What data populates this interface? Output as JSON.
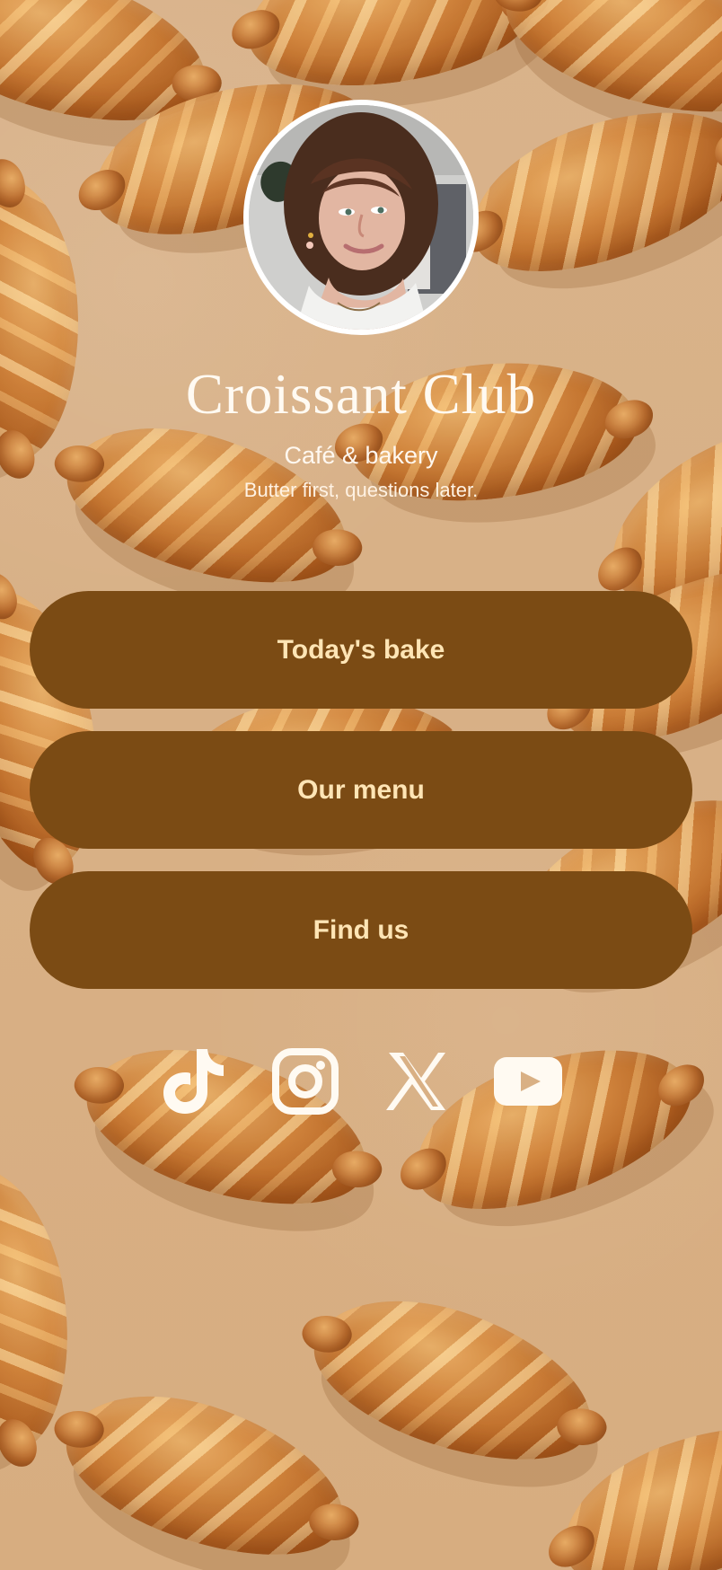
{
  "profile": {
    "title": "Croissant Club",
    "subtitle": "Café & bakery",
    "tagline": "Butter first, questions later."
  },
  "buttons": [
    {
      "label": "Today's bake"
    },
    {
      "label": "Our menu"
    },
    {
      "label": "Find us"
    }
  ],
  "social": {
    "items": [
      {
        "icon": "tiktok-icon"
      },
      {
        "icon": "instagram-icon"
      },
      {
        "icon": "x-icon"
      },
      {
        "icon": "youtube-icon"
      }
    ]
  },
  "colors": {
    "background": "#d9b084",
    "button": "#7b4b14",
    "button_text": "#ffe5b5",
    "text": "#fffaf2"
  }
}
